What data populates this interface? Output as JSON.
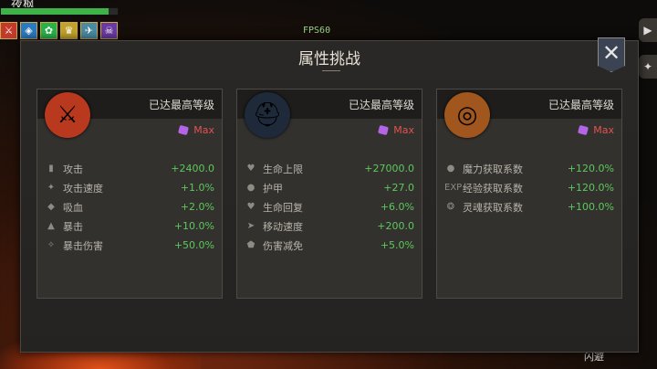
{
  "hud": {
    "player_name": "夜枫",
    "hp_fraction": 0.92,
    "fps": "FPS60",
    "dodge_label": "闪避",
    "buff_icons": [
      "sword-buff-icon",
      "shield-buff-icon",
      "leaf-buff-icon",
      "crown-buff-icon",
      "wing-buff-icon",
      "skull-buff-icon"
    ]
  },
  "panel": {
    "title": "属性挑战",
    "close_glyph": "✕"
  },
  "cards": [
    {
      "icon": "sword-icon",
      "icon_glyph": "⚔",
      "icon_color": "#b8391e",
      "level_text": "已达最高等级",
      "max_text": "Max",
      "stats": [
        {
          "icon": "attack-icon",
          "glyph": "▮",
          "name": "攻击",
          "value": "+2400.0"
        },
        {
          "icon": "attack-speed-icon",
          "glyph": "✦",
          "name": "攻击速度",
          "value": "+1.0%"
        },
        {
          "icon": "lifesteal-icon",
          "glyph": "◆",
          "name": "吸血",
          "value": "+2.0%"
        },
        {
          "icon": "crit-icon",
          "glyph": "▲",
          "name": "暴击",
          "value": "+10.0%"
        },
        {
          "icon": "crit-damage-icon",
          "glyph": "✧",
          "name": "暴击伤害",
          "value": "+50.0%"
        }
      ]
    },
    {
      "icon": "helmet-icon",
      "icon_glyph": "⛑",
      "icon_color": "#1e2a3a",
      "level_text": "已达最高等级",
      "max_text": "Max",
      "stats": [
        {
          "icon": "heart-icon",
          "glyph": "♥",
          "name": "生命上限",
          "value": "+27000.0"
        },
        {
          "icon": "armor-icon",
          "glyph": "●",
          "name": "护甲",
          "value": "+27.0"
        },
        {
          "icon": "regen-icon",
          "glyph": "♥",
          "name": "生命回复",
          "value": "+6.0%"
        },
        {
          "icon": "move-speed-icon",
          "glyph": "➤",
          "name": "移动速度",
          "value": "+200.0"
        },
        {
          "icon": "damage-reduction-icon",
          "glyph": "⬟",
          "name": "伤害减免",
          "value": "+5.0%"
        }
      ]
    },
    {
      "icon": "coins-icon",
      "icon_glyph": "◎",
      "icon_color": "#a0561c",
      "level_text": "已达最高等级",
      "max_text": "Max",
      "stats": [
        {
          "icon": "magic-power-icon",
          "glyph": "●",
          "name": "魔力获取系数",
          "value": "+120.0%"
        },
        {
          "icon": "exp-icon",
          "glyph": "EXP",
          "name": "经验获取系数",
          "value": "+120.0%"
        },
        {
          "icon": "soul-icon",
          "glyph": "❂",
          "name": "灵魂获取系数",
          "value": "+100.0%"
        }
      ]
    }
  ]
}
